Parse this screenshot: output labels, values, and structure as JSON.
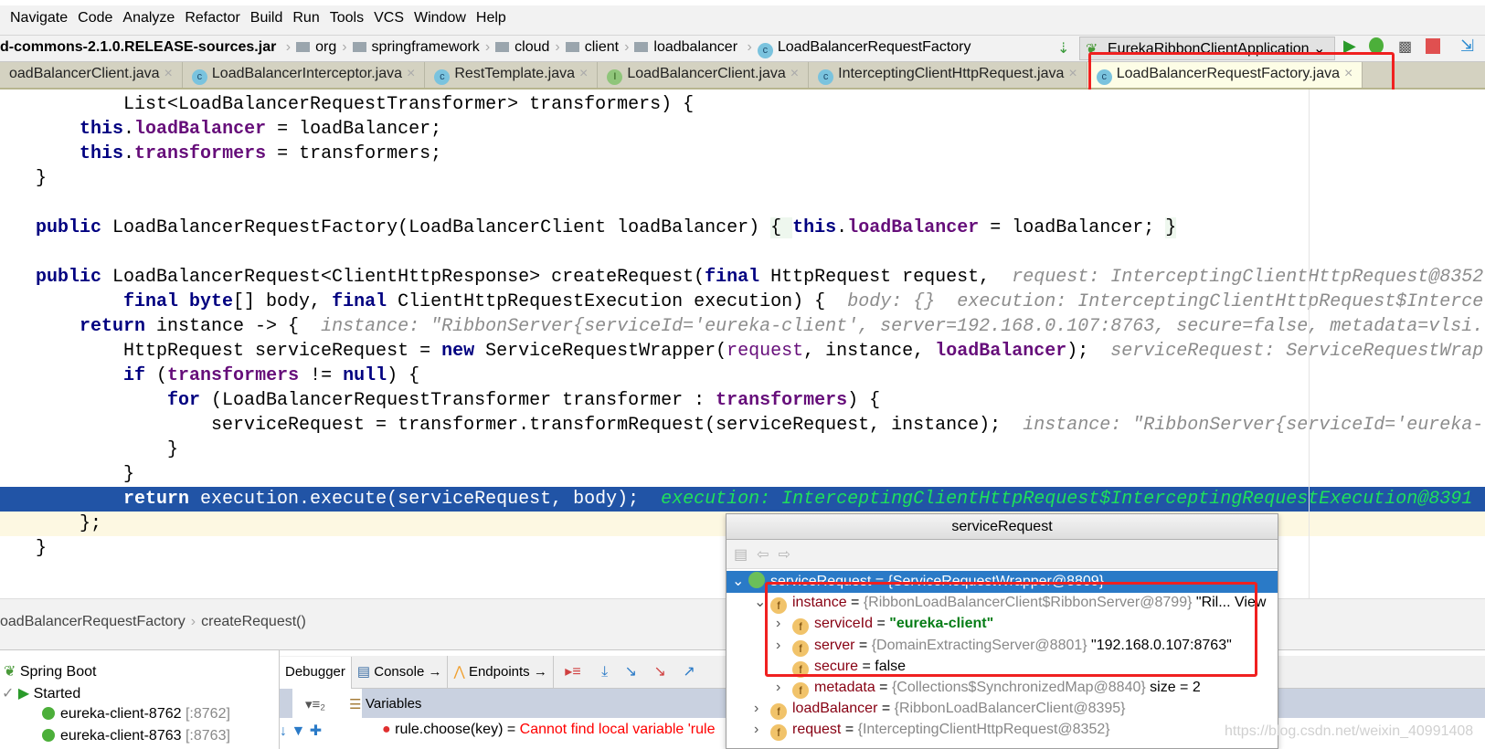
{
  "menu": [
    "Navigate",
    "Code",
    "Analyze",
    "Refactor",
    "Build",
    "Run",
    "Tools",
    "VCS",
    "Window",
    "Help"
  ],
  "breadcrumb": {
    "jar": "d-commons-2.1.0.RELEASE-sources.jar",
    "folders": [
      "org",
      "springframework",
      "cloud",
      "client",
      "loadbalancer"
    ],
    "class": "LoadBalancerRequestFactory"
  },
  "run_config": "EurekaRibbonClientApplication",
  "tabs": [
    {
      "label": "oadBalancerClient.java",
      "icon": "class"
    },
    {
      "label": "LoadBalancerInterceptor.java",
      "icon": "class"
    },
    {
      "label": "RestTemplate.java",
      "icon": "class"
    },
    {
      "label": "LoadBalancerClient.java",
      "icon": "interface"
    },
    {
      "label": "InterceptingClientHttpRequest.java",
      "icon": "class"
    },
    {
      "label": "LoadBalancerRequestFactory.java",
      "icon": "class",
      "active": true
    }
  ],
  "code": [
    {
      "indent": 8,
      "t": [
        [
          "",
          "List<LoadBalancerRequestTransformer> transformers) {"
        ]
      ]
    },
    {
      "indent": 4,
      "t": [
        [
          "kw",
          "this"
        ],
        [
          "",
          "."
        ],
        [
          "fld",
          "loadBalancer"
        ],
        [
          "",
          " = loadBalancer;"
        ]
      ]
    },
    {
      "indent": 4,
      "t": [
        [
          "kw",
          "this"
        ],
        [
          "",
          "."
        ],
        [
          "fld",
          "transformers"
        ],
        [
          "",
          " = transformers;"
        ]
      ]
    },
    {
      "indent": 0,
      "t": [
        [
          "",
          "}"
        ]
      ]
    },
    {
      "indent": 0,
      "t": []
    },
    {
      "indent": 0,
      "t": [
        [
          "kw",
          "public"
        ],
        [
          "",
          " LoadBalancerRequestFactory(LoadBalancerClient loadBalancer) "
        ],
        [
          "fold",
          "{ "
        ],
        [
          "kw",
          "this"
        ],
        [
          "",
          "."
        ],
        [
          "fld",
          "loadBalancer"
        ],
        [
          "",
          " = loadBalancer; "
        ],
        [
          "fold",
          "}"
        ]
      ]
    },
    {
      "indent": 0,
      "t": []
    },
    {
      "indent": 0,
      "t": [
        [
          "kw",
          "public"
        ],
        [
          "",
          " LoadBalancerRequest<ClientHttpResponse> createRequest("
        ],
        [
          "kw",
          "final"
        ],
        [
          "",
          " HttpRequest request,  "
        ],
        [
          "hint",
          "request: InterceptingClientHttpRequest@8352"
        ]
      ]
    },
    {
      "indent": 8,
      "t": [
        [
          "kw",
          "final byte"
        ],
        [
          "",
          "[] body, "
        ],
        [
          "kw",
          "final"
        ],
        [
          "",
          " ClientHttpRequestExecution execution) {  "
        ],
        [
          "hint",
          "body: {}  execution: InterceptingClientHttpRequest$Interce"
        ]
      ]
    },
    {
      "indent": 4,
      "t": [
        [
          "kw",
          "return"
        ],
        [
          "",
          " instance -> {  "
        ],
        [
          "hint",
          "instance: \"RibbonServer{serviceId='eureka-client', server=192.168.0.107:8763, secure=false, metadata=vlsi."
        ]
      ]
    },
    {
      "indent": 8,
      "t": [
        [
          "",
          "HttpRequest serviceRequest = "
        ],
        [
          "kw",
          "new"
        ],
        [
          "",
          " ServiceRequestWrapper("
        ],
        [
          "par",
          "request"
        ],
        [
          "",
          ", instance, "
        ],
        [
          "fld",
          "loadBalancer"
        ],
        [
          "",
          ");  "
        ],
        [
          "hint",
          "serviceRequest: ServiceRequestWrap"
        ]
      ]
    },
    {
      "indent": 8,
      "t": [
        [
          "kw",
          "if"
        ],
        [
          "",
          " ("
        ],
        [
          "fld",
          "transformers"
        ],
        [
          "",
          " != "
        ],
        [
          "kw",
          "null"
        ],
        [
          "",
          ") {"
        ]
      ]
    },
    {
      "indent": 12,
      "t": [
        [
          "kw",
          "for"
        ],
        [
          "",
          " (LoadBalancerRequestTransformer transformer : "
        ],
        [
          "fld",
          "transformers"
        ],
        [
          "",
          ") {"
        ]
      ]
    },
    {
      "indent": 16,
      "t": [
        [
          "",
          "serviceRequest = transformer.transformRequest(serviceRequest, instance);  "
        ],
        [
          "hint",
          "instance: \"RibbonServer{serviceId='eureka-"
        ]
      ]
    },
    {
      "indent": 12,
      "t": [
        [
          "",
          "}"
        ]
      ]
    },
    {
      "indent": 8,
      "t": [
        [
          "",
          "}"
        ]
      ]
    },
    {
      "indent": 8,
      "style": "hl",
      "t": [
        [
          "kw",
          "return"
        ],
        [
          "",
          " execution.execute(serviceRequest, body);  "
        ],
        [
          "hint",
          "execution: InterceptingClientHttpRequest$InterceptingRequestExecution@8391"
        ]
      ]
    },
    {
      "indent": 4,
      "style": "yl",
      "t": [
        [
          "",
          "};"
        ]
      ]
    },
    {
      "indent": 0,
      "t": [
        [
          "",
          "}"
        ]
      ]
    }
  ],
  "editor_breadcrumb": [
    "oadBalancerRequestFactory",
    "createRequest()"
  ],
  "services": {
    "root": "Spring Boot",
    "group": "Started",
    "items": [
      {
        "name": "eureka-client-8762",
        "port": "[:8762]"
      },
      {
        "name": "eureka-client-8763",
        "port": "[:8763]"
      }
    ]
  },
  "debug_tabs": [
    "Debugger",
    "Console",
    "Endpoints"
  ],
  "variables_label": "Variables",
  "error_row": {
    "expr": "rule.choose(key) = ",
    "msg": "Cannot find local variable 'rule"
  },
  "popup": {
    "title": "serviceRequest",
    "rows": [
      {
        "name": "serviceRequest",
        "eq": " = ",
        "type": "{ServiceRequestWrapper@8809}",
        "extra": "",
        "level": 0,
        "expanded": true,
        "selected": true
      },
      {
        "name": "instance",
        "eq": " = ",
        "type": "{RibbonLoadBalancerClient$RibbonServer@8799}",
        "extra": " \"Ril... View",
        "level": 1,
        "expanded": true
      },
      {
        "name": "serviceId",
        "eq": " = ",
        "str": "\"eureka-client\"",
        "level": 2,
        "collapsed": true
      },
      {
        "name": "server",
        "eq": " = ",
        "type": "{DomainExtractingServer@8801}",
        "extra": " \"192.168.0.107:8763\"",
        "level": 2,
        "collapsed": true
      },
      {
        "name": "secure",
        "eq": " = ",
        "extra": "false",
        "level": 2
      },
      {
        "name": "metadata",
        "eq": " = ",
        "type": "{Collections$SynchronizedMap@8840}",
        "extra": "  size = 2",
        "level": 2,
        "collapsed": true
      },
      {
        "name": "loadBalancer",
        "eq": " = ",
        "type": "{RibbonLoadBalancerClient@8395}",
        "level": 1,
        "collapsed": true
      },
      {
        "name": "request",
        "eq": " = ",
        "type": "{InterceptingClientHttpRequest@8352}",
        "level": 1,
        "collapsed": true
      }
    ]
  },
  "watermark": "https://blog.csdn.net/weixin_40991408",
  "colors": {
    "highlight": "#2154a6",
    "annotation": "#f02020",
    "keyword": "#000080",
    "field": "#660e7a"
  }
}
